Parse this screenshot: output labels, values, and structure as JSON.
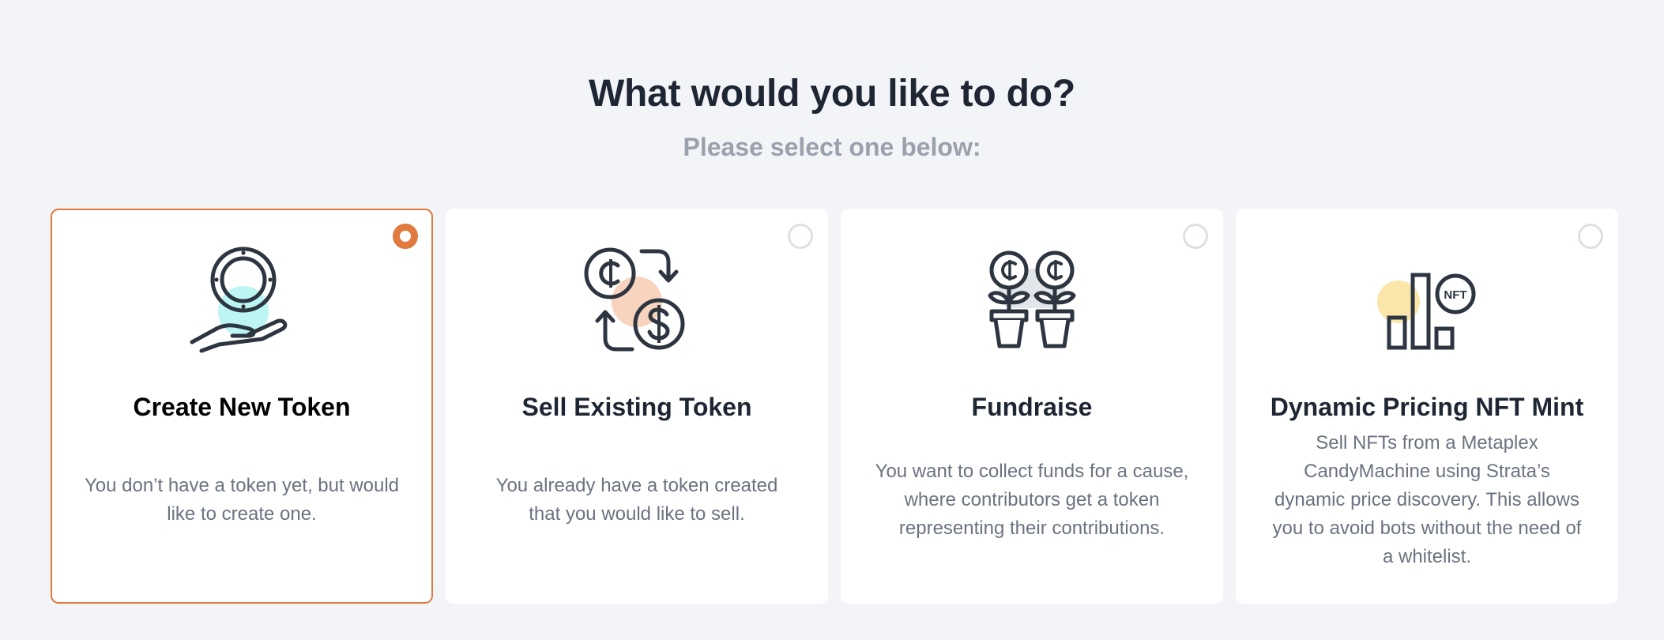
{
  "header": {
    "title": "What would you like to do?",
    "subtitle": "Please select one below:"
  },
  "colors": {
    "accent": "#e07a3f",
    "background": "#f2f4f7",
    "card": "#ffffff",
    "title_text": "#1f2633",
    "subtitle_text": "#9aa1ad",
    "body_text": "#6b7280"
  },
  "options": [
    {
      "id": "create-new-token",
      "title": "Create New Token",
      "description": "You don’t have a token yet, but would like to create one.",
      "icon": "coin-in-hand-icon",
      "selected": true
    },
    {
      "id": "sell-existing-token",
      "title": "Sell Existing Token",
      "description": "You already have a token created that you would like to sell.",
      "icon": "token-exchange-icon",
      "selected": false
    },
    {
      "id": "fundraise",
      "title": "Fundraise",
      "description": "You want to collect funds for a cause, where contributors get a token representing their contributions.",
      "icon": "potted-coin-plants-icon",
      "selected": false
    },
    {
      "id": "dynamic-pricing-nft-mint",
      "title": "Dynamic Pricing NFT Mint",
      "description": "Sell NFTs from a Metaplex CandyMachine using Strata’s dynamic price discovery. This allows you to avoid bots without the need of a whitelist.",
      "icon": "nft-bar-chart-icon",
      "icon_label": "NFT",
      "selected": false
    }
  ]
}
